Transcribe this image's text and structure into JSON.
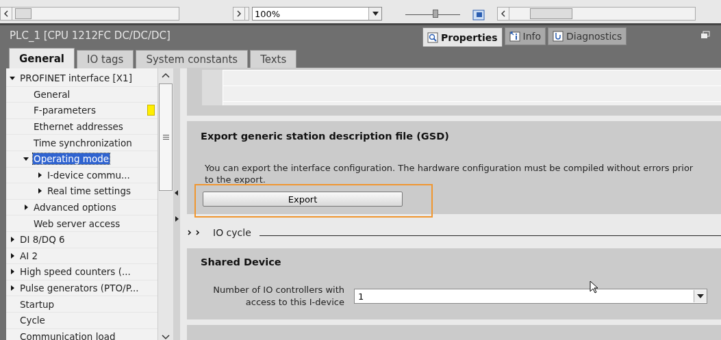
{
  "toolbar": {
    "zoom": "100%",
    "zoom_slider": {
      "level": 0.55
    }
  },
  "inspector": {
    "title": "PLC_1 [CPU 1212FC DC/DC/DC]",
    "tabs": [
      {
        "label": "Properties",
        "selected": true
      },
      {
        "label": "Info",
        "selected": false
      },
      {
        "label": "Diagnostics",
        "selected": false
      }
    ]
  },
  "subtabs": [
    {
      "label": "General",
      "selected": true
    },
    {
      "label": "IO tags",
      "selected": false
    },
    {
      "label": "System constants",
      "selected": false
    },
    {
      "label": "Texts",
      "selected": false
    }
  ],
  "tree": [
    {
      "label": "PROFINET interface [X1]",
      "expanded": true,
      "selected": false,
      "children": [
        {
          "label": "General",
          "selected": false
        },
        {
          "label": "F-parameters",
          "selected": false,
          "marker": true
        },
        {
          "label": "Ethernet addresses",
          "selected": false
        },
        {
          "label": "Time synchronization",
          "selected": false
        },
        {
          "label": "Operating mode",
          "expanded": true,
          "selected": true,
          "children": [
            {
              "label": "I-device commu...",
              "expanded": false,
              "selected": false
            },
            {
              "label": "Real time settings",
              "expanded": false,
              "selected": false
            }
          ]
        },
        {
          "label": "Advanced options",
          "expanded": false,
          "selected": false
        },
        {
          "label": "Web server access",
          "selected": false
        }
      ]
    },
    {
      "label": "DI 8/DQ 6",
      "expanded": false,
      "selected": false
    },
    {
      "label": "AI 2",
      "expanded": false,
      "selected": false
    },
    {
      "label": "High speed counters (...",
      "expanded": false,
      "selected": false
    },
    {
      "label": "Pulse generators (PTO/P...",
      "expanded": false,
      "selected": false
    },
    {
      "label": "Startup",
      "selected": false
    },
    {
      "label": "Cycle",
      "selected": false
    },
    {
      "label": "Communication load",
      "selected": false
    }
  ],
  "export_section": {
    "heading": "Export generic station description file (GSD)",
    "text": "You can export the interface configuration. The hardware configuration must be compiled without errors prior to the export.",
    "button": "Export",
    "highlighted": true
  },
  "io_cycle": {
    "label": "IO cycle",
    "expanded": false
  },
  "shared_device": {
    "heading": "Shared Device",
    "field_label": "Number of IO controllers with access to this I-device",
    "value": "1"
  }
}
